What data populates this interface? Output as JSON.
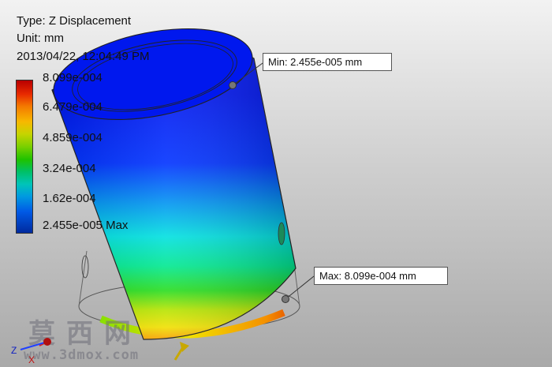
{
  "result": {
    "type_line": "Type: Z Displacement",
    "unit_line": "Unit: mm",
    "date_line": "2013/04/22, 12:04:49 PM"
  },
  "legend": {
    "labels": [
      "8.099e-004",
      "6.479e-004",
      "4.859e-004",
      "3.24e-004",
      "1.62e-004",
      "2.455e-005 Max"
    ],
    "colors": [
      "#b80000",
      "#f47a00",
      "#c7d400",
      "#1ec200",
      "#00c4b8",
      "#002a9e"
    ]
  },
  "probes": {
    "min_label": "Min: 2.455e-005 mm",
    "max_label": "Max: 8.099e-004 mm"
  },
  "watermark": {
    "cjk": "莫西网",
    "url": "www.3dmox.com"
  },
  "triad": {
    "axis_z": "Z",
    "axis_x": "X",
    "colors": {
      "z": "#2040ff",
      "x": "#e02020",
      "origin": "#b01010"
    }
  }
}
